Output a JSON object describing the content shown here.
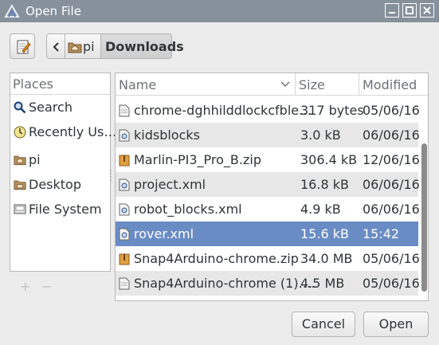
{
  "window": {
    "title": "Open File",
    "titlebar_color": "#87919b",
    "controls": [
      "minimize-icon",
      "maximize-icon",
      "close-icon"
    ]
  },
  "toolbar": {
    "edit_icon": "pencil-notepad-icon",
    "back_icon": "chevron-left-icon",
    "path": [
      {
        "label": "pi",
        "icon": "home-folder-icon"
      },
      {
        "label": "Downloads",
        "active": true
      }
    ]
  },
  "places": {
    "header": "Places",
    "items": [
      {
        "label": "Search",
        "icon": "search-icon"
      },
      {
        "label": "Recently Us…",
        "icon": "clock-icon"
      },
      {
        "label": "pi",
        "icon": "home-folder-icon"
      },
      {
        "label": "Desktop",
        "icon": "desktop-folder-icon"
      },
      {
        "label": "File System",
        "icon": "drive-icon"
      }
    ],
    "add_label": "+",
    "remove_label": "−"
  },
  "filelist": {
    "columns": {
      "name": "Name",
      "size": "Size",
      "modified": "Modified"
    },
    "sort_icon": "chevron-down-icon",
    "selected_color": "#6a8cc5",
    "rows": [
      {
        "name": "chrome-dghhilddlockcfble…",
        "size": "317 bytes",
        "modified": "05/06/16",
        "icon": "text-file-icon"
      },
      {
        "name": "kidsblocks",
        "size": "3.0 kB",
        "modified": "06/06/16",
        "icon": "xml-file-icon"
      },
      {
        "name": "Marlin-PI3_Pro_B.zip",
        "size": "306.4 kB",
        "modified": "12/06/16",
        "icon": "archive-icon"
      },
      {
        "name": "project.xml",
        "size": "16.8 kB",
        "modified": "06/06/16",
        "icon": "xml-file-icon"
      },
      {
        "name": "robot_blocks.xml",
        "size": "4.9 kB",
        "modified": "06/06/16",
        "icon": "xml-file-icon"
      },
      {
        "name": "rover.xml",
        "size": "15.6 kB",
        "modified": "15:42",
        "icon": "xml-file-icon",
        "selected": true
      },
      {
        "name": "Snap4Arduino-chrome.zip",
        "size": "34.0 MB",
        "modified": "05/06/16",
        "icon": "archive-icon"
      },
      {
        "name": "Snap4Arduino-chrome (1)….",
        "size": "4.5 MB",
        "modified": "05/06/16",
        "icon": "text-file-icon"
      }
    ]
  },
  "actions": {
    "cancel": "Cancel",
    "open": "Open"
  }
}
